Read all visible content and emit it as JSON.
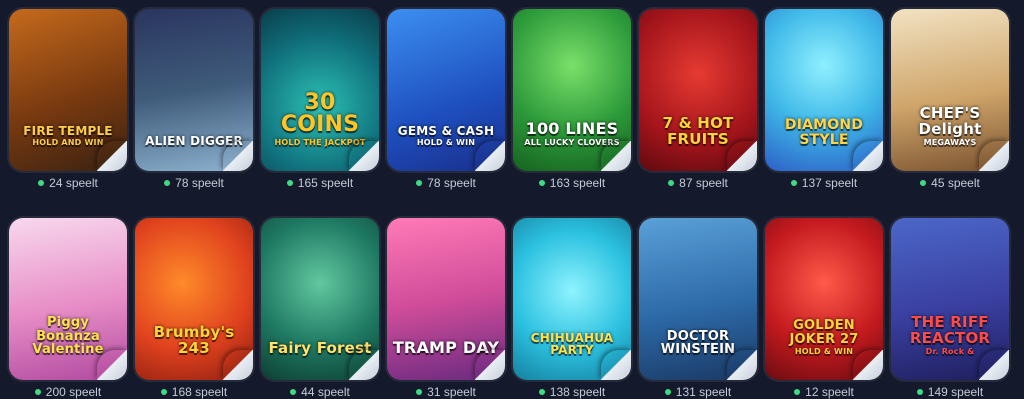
{
  "games": [
    {
      "title": "FIRE TEMPLE",
      "subtitle": "HOLD AND WIN",
      "players": "24 speelt",
      "bg": "linear-gradient(160deg,#c56a1c,#7a3a10 55%,#3a2212)",
      "titleColor": "#ffcf4a",
      "size": 12
    },
    {
      "title": "ALIEN DIGGER",
      "subtitle": "",
      "players": "78 speelt",
      "bg": "linear-gradient(170deg,#2a3560,#3f5b7a 50%,#8db2cf)",
      "titleColor": "#ffffff",
      "size": 12
    },
    {
      "title": "30 COINS",
      "subtitle": "HOLD THE JACKPOT",
      "players": "165 speelt",
      "bg": "radial-gradient(circle at 50% 60%,#2cc0b5,#0f6e7a 60%,#0a3e4a)",
      "titleColor": "#ffc526",
      "size": 22
    },
    {
      "title": "GEMS & CASH",
      "subtitle": "HOLD & WIN",
      "players": "78 speelt",
      "bg": "linear-gradient(160deg,#3c8ff0,#1e4fbf 60%,#1a2f8a)",
      "titleColor": "#ffffff",
      "size": 12
    },
    {
      "title": "100 LINES",
      "subtitle": "ALL LUCKY CLOVERS",
      "players": "163 speelt",
      "bg": "radial-gradient(circle at 50% 35%,#7be06a,#2c9a3a 55%,#16611f)",
      "titleColor": "#ffffff",
      "size": 16
    },
    {
      "title": "7 & HOT FRUITS",
      "subtitle": "",
      "players": "87 speelt",
      "bg": "radial-gradient(circle at 50% 40%,#e63a32,#a3141b 60%,#5e0a10)",
      "titleColor": "#ffd23a",
      "size": 15
    },
    {
      "title": "DIAMOND STYLE",
      "subtitle": "",
      "players": "137 speelt",
      "bg": "radial-gradient(circle at 50% 35%,#8ff0ff,#3fb8e8 50%,#2c5fc7)",
      "titleColor": "#ffd447",
      "size": 14
    },
    {
      "title": "CHEF'S Delight",
      "subtitle": "MEGAWAYS",
      "players": "45 speelt",
      "bg": "linear-gradient(170deg,#f2e2c2,#cfa56a 55%,#7a5230)",
      "titleColor": "#ffffff",
      "size": 15
    },
    {
      "title": "Piggy Bonanza Valentine",
      "subtitle": "",
      "players": "200 speelt",
      "bg": "linear-gradient(170deg,#f8d8ee,#e78cc6 55%,#b14aa0)",
      "titleColor": "#ffe14a",
      "size": 13
    },
    {
      "title": "Brumby's 243",
      "subtitle": "",
      "players": "168 speelt",
      "bg": "radial-gradient(circle at 40% 40%,#ff8a2a,#e0421e 55%,#8a1d10)",
      "titleColor": "#ffd23a",
      "size": 15
    },
    {
      "title": "Fairy Forest",
      "subtitle": "",
      "players": "44 speelt",
      "bg": "radial-gradient(circle at 50% 40%,#62c8a0,#1f7a63 55%,#0d3e33)",
      "titleColor": "#ffe36b",
      "size": 15
    },
    {
      "title": "TRAMP DAY",
      "subtitle": "",
      "players": "31 speelt",
      "bg": "linear-gradient(170deg,#ff7ab6,#d14d9a 50%,#6a2a80)",
      "titleColor": "#ffffff",
      "size": 16
    },
    {
      "title": "CHIHUAHUA PARTY",
      "subtitle": "",
      "players": "138 speelt",
      "bg": "radial-gradient(circle at 50% 45%,#8ff3ff,#2cc1e0 55%,#157f9e)",
      "titleColor": "#ffe14a",
      "size": 12
    },
    {
      "title": "DOCTOR WINSTEIN",
      "subtitle": "",
      "players": "131 speelt",
      "bg": "linear-gradient(170deg,#5aa0d8,#2d6aa8 55%,#1a3a66)",
      "titleColor": "#ffffff",
      "size": 13
    },
    {
      "title": "GOLDEN JOKER 27",
      "subtitle": "HOLD & WIN",
      "players": "12 speelt",
      "bg": "radial-gradient(circle at 50% 40%,#ff5a4a,#c41a1f 55%,#6a0c10)",
      "titleColor": "#ffd23a",
      "size": 13
    },
    {
      "title": "THE RIFF REACTOR",
      "subtitle": "Dr. Rock &",
      "players": "149 speelt",
      "bg": "linear-gradient(170deg,#4b67c9,#3a3fa0 55%,#1f1f5e)",
      "titleColor": "#ff4a4a",
      "size": 15
    }
  ],
  "colors": {
    "page_bg": "#141a2b",
    "online_dot": "#3ddc84",
    "count_text": "#c6cad6"
  },
  "icons": {
    "curl": "page-curl-icon",
    "dot": "online-dot-icon"
  }
}
